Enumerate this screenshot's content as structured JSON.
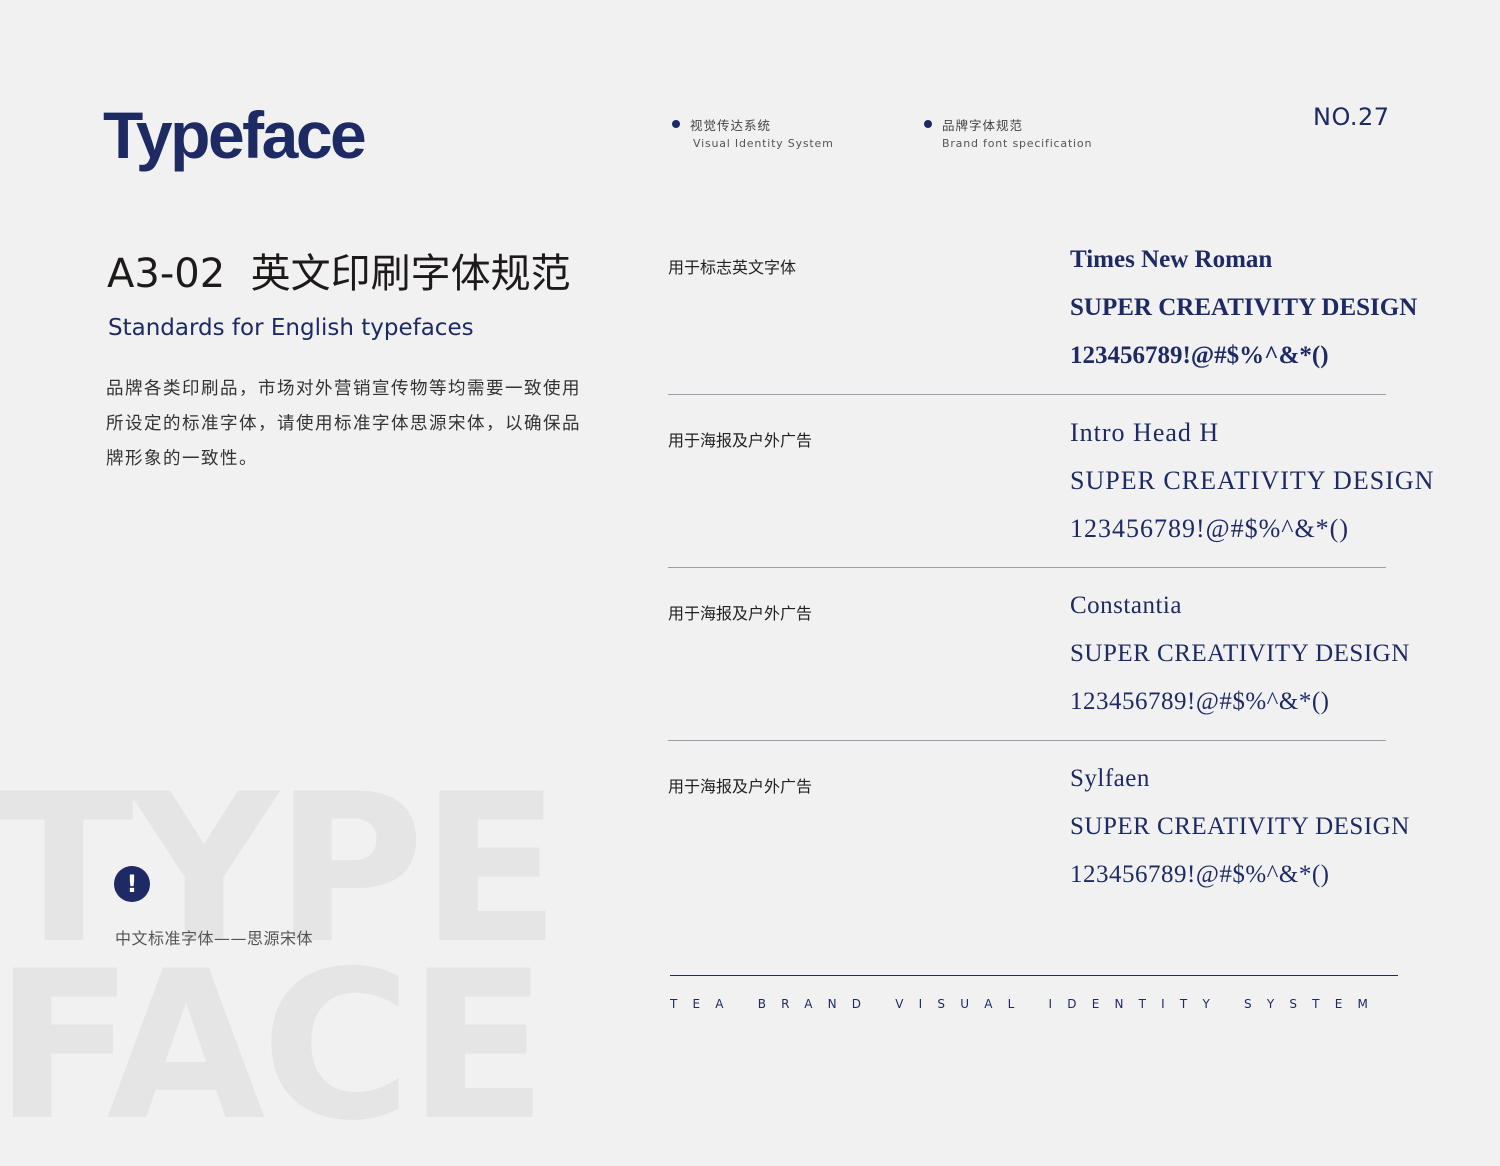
{
  "watermark": {
    "line1": "TYPE",
    "line2": "FACE"
  },
  "header": {
    "logo_word": "Typeface",
    "nav": [
      {
        "cn": "视觉传达系统",
        "en": "Visual Identity System"
      },
      {
        "cn": "品牌字体规范",
        "en": "Brand font specification"
      }
    ],
    "page_number": "NO.27"
  },
  "section": {
    "code_title": "A3-02  英文印刷字体规范",
    "subtitle": "Standards for English typefaces",
    "description_lines": [
      "品牌各类印刷品，市场对外营销宣传物等均需要一致使用",
      "所设定的标准字体，请使用标准字体思源宋体，以确保品",
      "牌形象的一致性。"
    ]
  },
  "note": {
    "icon": "exclamation-icon",
    "text": "中文标准字体——思源宋体"
  },
  "fonts": [
    {
      "usage": "用于标志英文字体",
      "name": "Times New Roman",
      "caps": "SUPER CREATIVITY DESIGN",
      "numbers": "123456789!@#$%^&*()"
    },
    {
      "usage": "用于海报及户外广告",
      "name": "Intro Head H",
      "caps": "SUPER CREATIVITY DESIGN",
      "numbers": "123456789!@#$%^&*()"
    },
    {
      "usage": "用于海报及户外广告",
      "name": "Constantia",
      "caps": "SUPER CREATIVITY DESIGN",
      "numbers": "123456789!@#$%^&*()"
    },
    {
      "usage": "用于海报及户外广告",
      "name": "Sylfaen",
      "caps": "SUPER CREATIVITY DESIGN",
      "numbers": "123456789!@#$%^&*()"
    }
  ],
  "footer": {
    "text": "TEA BRAND VISUAL IDENTITY SYSTEM"
  },
  "colors": {
    "navy": "#1d2a64",
    "background": "#f1f1f2",
    "watermark": "#e6e5e6"
  }
}
